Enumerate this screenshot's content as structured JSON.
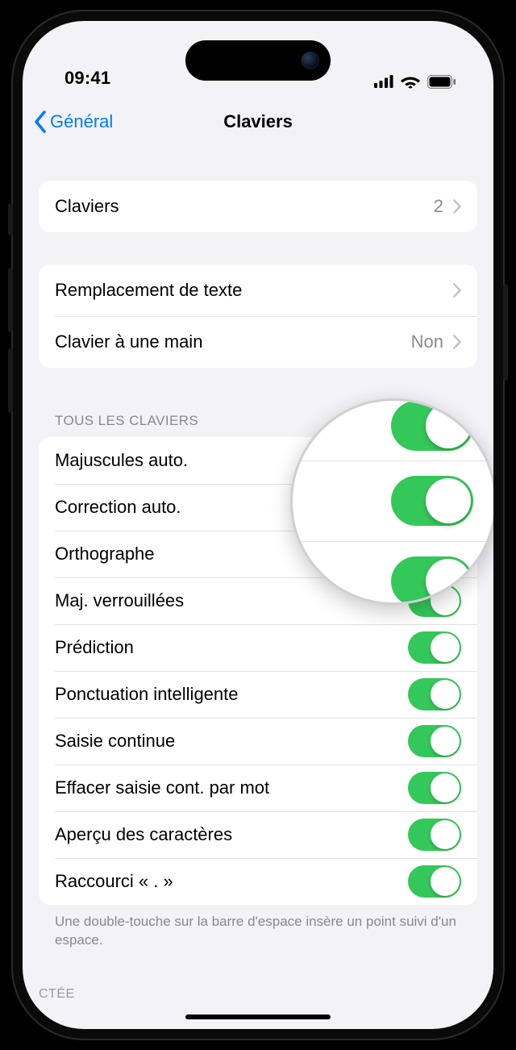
{
  "status": {
    "time": "09:41"
  },
  "nav": {
    "back_label": "Général",
    "title": "Claviers"
  },
  "group1": {
    "keyboards_label": "Claviers",
    "keyboards_count": "2"
  },
  "group2": {
    "text_replacement_label": "Remplacement de texte",
    "one_handed_label": "Clavier à une main",
    "one_handed_value": "Non"
  },
  "section_header": "Tous les claviers",
  "toggles": {
    "auto_cap": "Majuscules auto.",
    "auto_correct": "Correction auto.",
    "spellcheck": "Orthographe",
    "caps_lock": "Maj. verrouillées",
    "prediction": "Prédiction",
    "smart_punct": "Ponctuation intelligente",
    "slide": "Saisie continue",
    "delete_slide": "Effacer saisie cont. par mot",
    "char_preview": "Aperçu des caractères",
    "period_shortcut": "Raccourci « . »"
  },
  "footer": "Une double-touche sur la barre d'espace insère un point suivi d'un espace.",
  "peek": "CTÉE"
}
